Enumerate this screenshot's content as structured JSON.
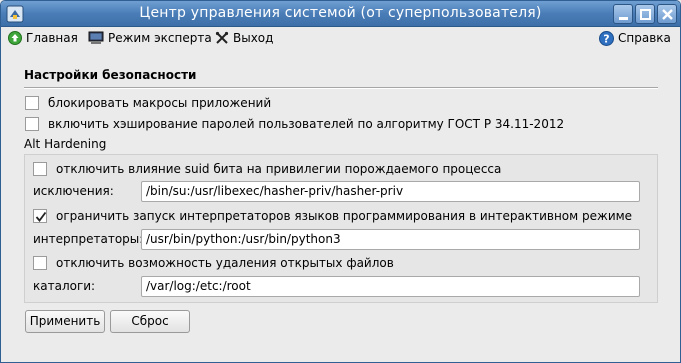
{
  "window": {
    "title": "Центр управления системой (от суперпользователя)"
  },
  "toolbar": {
    "home_label": "Главная",
    "expert_label": "Режим эксперта",
    "exit_label": "Выход",
    "help_label": "Справка"
  },
  "security": {
    "section_title": "Настройки безопасности",
    "block_macros": {
      "label": "блокировать макросы приложений",
      "checked": false
    },
    "hash_passwords": {
      "label": "включить хэширование паролей пользователей по алгоритму ГОСТ Р 34.11-2012",
      "checked": false
    }
  },
  "alt_hardening": {
    "group_label": "Alt Hardening",
    "suid": {
      "label": "отключить влияние suid бита на привилегии порождаемого процесса",
      "checked": false
    },
    "exceptions": {
      "label": "исключения:",
      "value": "/bin/su:/usr/libexec/hasher-priv/hasher-priv"
    },
    "interpreters_limit": {
      "label": "ограничить запуск интерпретаторов языков программирования в интерактивном режиме",
      "checked": true
    },
    "interpreters": {
      "label": "интерпретаторы:",
      "value": "/usr/bin/python:/usr/bin/python3"
    },
    "deleted_files": {
      "label": "отключить возможность удаления открытых файлов",
      "checked": false
    },
    "catalogs": {
      "label": "каталоги:",
      "value": "/var/log:/etc:/root"
    }
  },
  "actions": {
    "apply_label": "Применить",
    "reset_label": "Сброс"
  }
}
